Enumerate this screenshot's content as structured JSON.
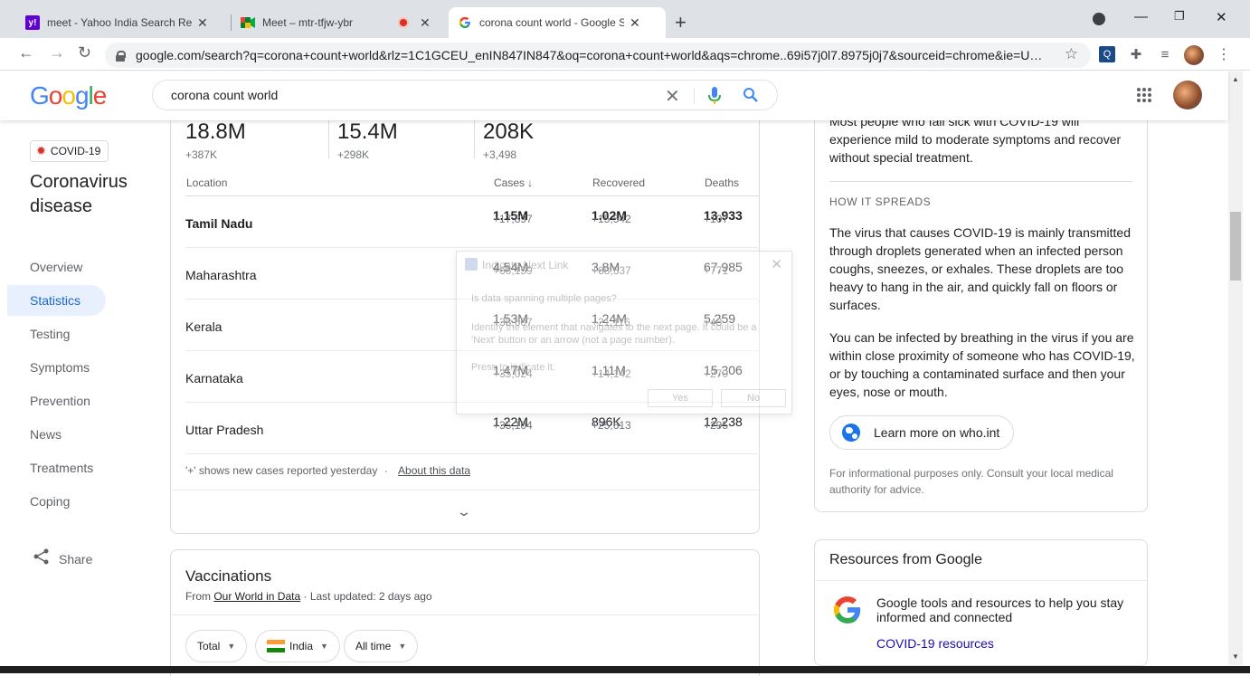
{
  "browser": {
    "tabs": [
      {
        "title": "meet - Yahoo India Search Results",
        "favicon": "y!",
        "favicon_color": "#6001d2"
      },
      {
        "title": "Meet – mtr-tfjw-ybr",
        "favicon": "meet-icon"
      },
      {
        "title": "corona count world - Google Search",
        "favicon": "G",
        "active": true
      }
    ],
    "url": "google.com/search?q=corona+count+world&rlz=1C1GCEU_enIN847IN847&oq=corona+count+world&aqs=chrome..69i57j0l7.8975j0j7&sourceid=chrome&ie=U…"
  },
  "search": {
    "query": "corona count world"
  },
  "sidebar": {
    "chip": "COVID-19",
    "title": "Coronavirus disease",
    "items": [
      {
        "label": "Overview"
      },
      {
        "label": "Statistics",
        "active": true
      },
      {
        "label": "Testing"
      },
      {
        "label": "Symptoms"
      },
      {
        "label": "Prevention"
      },
      {
        "label": "News"
      },
      {
        "label": "Treatments"
      },
      {
        "label": "Coping"
      }
    ],
    "share": "Share"
  },
  "stats": {
    "totals": [
      {
        "value": "18.8M",
        "delta": "+387K"
      },
      {
        "value": "15.4M",
        "delta": "+298K"
      },
      {
        "value": "208K",
        "delta": "+3,498"
      }
    ],
    "headers": {
      "location": "Location",
      "cases": "Cases",
      "recovered": "Recovered",
      "deaths": "Deaths"
    },
    "rows": [
      {
        "location": "Tamil Nadu",
        "cases": "1.15M",
        "cases_d": "+17,897",
        "rec": "1.02M",
        "rec_d": "+15,542",
        "deaths": "13,933",
        "deaths_d": "+107"
      },
      {
        "location": "Maharashtra",
        "cases": "4.54M",
        "cases_d": "+66,159",
        "rec": "3.8M",
        "rec_d": "+68,537",
        "deaths": "67,985",
        "deaths_d": "+771"
      },
      {
        "location": "Kerala",
        "cases": "1.53M",
        "cases_d": "+38,607",
        "rec": "1.24M",
        "rec_d": "+21,116",
        "deaths": "5,259",
        "deaths_d": "+48"
      },
      {
        "location": "Karnataka",
        "cases": "1.47M",
        "cases_d": "+35,024",
        "rec": "1.11M",
        "rec_d": "+14,142",
        "deaths": "15,306",
        "deaths_d": "+270"
      },
      {
        "location": "Uttar Pradesh",
        "cases": "1.22M",
        "cases_d": "+35,104",
        "rec": "896K",
        "rec_d": "+25,613",
        "deaths": "12,238",
        "deaths_d": "+295"
      }
    ],
    "footnote": "'+' shows new cases reported yesterday",
    "about_link": "About this data"
  },
  "overlay": {
    "title": "Indicate Next Link",
    "question": "Is data spanning multiple pages?",
    "description": "Identify the element that navigates to the next page. It could be a 'Next' button or an arrow (not a page number).",
    "prompt": "Press to indicate it.",
    "yes": "Yes",
    "no": "No"
  },
  "vaccinations": {
    "title": "Vaccinations",
    "source_prefix": "From",
    "source_link": "Our World in Data",
    "updated": "· Last updated: 2 days ago",
    "filters": {
      "total": "Total",
      "country": "India",
      "time": "All time"
    }
  },
  "info": {
    "p1": "Most people who fall sick with COVID-19 will experience mild to moderate symptoms and recover without special treatment.",
    "heading": "HOW IT SPREADS",
    "p2": "The virus that causes COVID-19 is mainly transmitted through droplets generated when an infected person coughs, sneezes, or exhales. These droplets are too heavy to hang in the air, and quickly fall on floors or surfaces.",
    "p3": "You can be infected by breathing in the virus if you are within close proximity of someone who has COVID-19, or by touching a contaminated surface and then your eyes, nose or mouth.",
    "learn": "Learn more on who.int",
    "disclaimer": "For informational purposes only. Consult your local medical authority for advice."
  },
  "resources": {
    "title": "Resources from Google",
    "text": "Google tools and resources to help you stay informed and connected",
    "link": "COVID-19 resources"
  },
  "colors": {
    "accent": "#1a73e8",
    "link": "#1a0dab",
    "active_bg": "#e8f0fe"
  }
}
